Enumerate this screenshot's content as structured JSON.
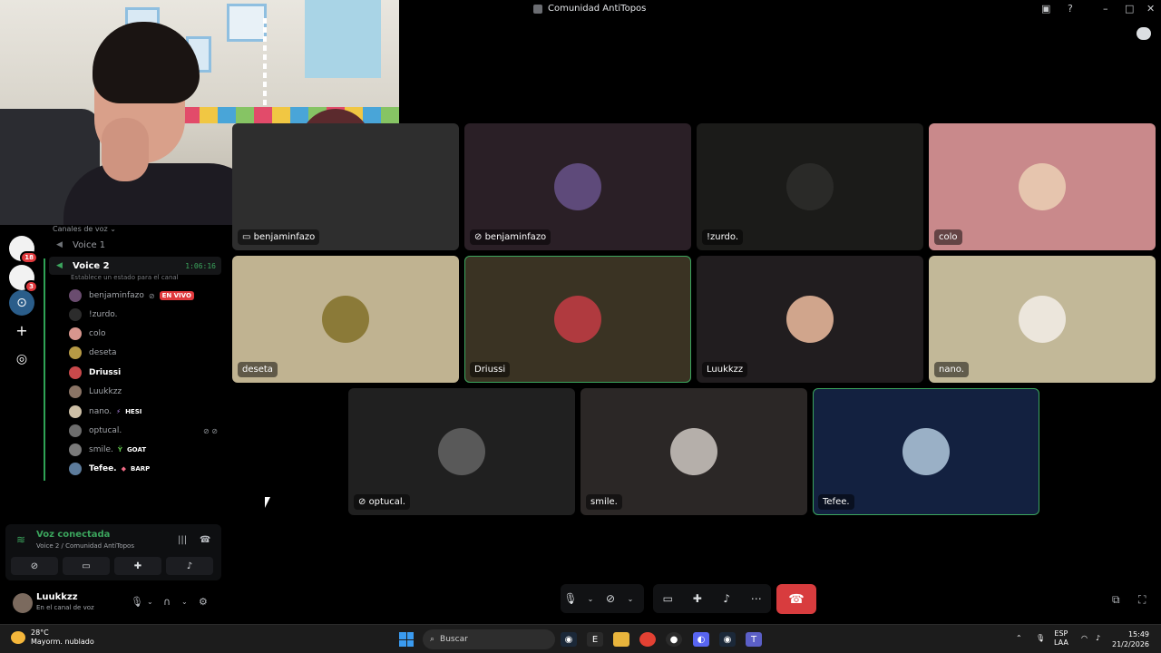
{
  "window": {
    "title": "Comunidad AntiTopos"
  },
  "servers": [
    {
      "badge": "18",
      "color": "#ffffff"
    },
    {
      "badge": "3",
      "color": "#ffffff"
    },
    {
      "badge": "",
      "color": "#2a5d8a"
    }
  ],
  "channels": {
    "category": "Canales de voz",
    "voice1": "Voice 1",
    "voice2": "Voice 2",
    "timer": "1:06:16",
    "status_placeholder": "Establece un estado para el canal"
  },
  "members": [
    {
      "name": "benjaminfazo",
      "live": "EN VIVO",
      "tag": "",
      "color": "#6a4c6f",
      "bold": false
    },
    {
      "name": "!zurdo.",
      "live": "",
      "tag": "",
      "color": "#2c2c2c",
      "bold": false
    },
    {
      "name": "colo",
      "live": "",
      "tag": "",
      "color": "#d8968e",
      "bold": false
    },
    {
      "name": "deseta",
      "live": "",
      "tag": "",
      "color": "#b79a45",
      "bold": false
    },
    {
      "name": "Driussi",
      "live": "",
      "tag": "",
      "color": "#c9494b",
      "bold": true
    },
    {
      "name": "Luukkzz",
      "live": "",
      "tag": "",
      "color": "#8a7465",
      "bold": false
    },
    {
      "name": "nano.",
      "live": "",
      "tag": "HESI",
      "color": "#cdbfa6",
      "bold": false
    },
    {
      "name": "optucal.",
      "live": "",
      "tag": "",
      "color": "#6d6d6d",
      "bold": false
    },
    {
      "name": "smile.",
      "live": "",
      "tag": "GOAT",
      "color": "#7a7a7a",
      "bold": false
    },
    {
      "name": "Tefee.",
      "live": "",
      "tag": "BARP",
      "color": "#5d7c9c",
      "bold": true
    }
  ],
  "voice_panel": {
    "title": "Voz conectada",
    "subtitle": "Voice 2 / Comunidad AntiTopos"
  },
  "user": {
    "name": "Luukkzz",
    "status": "En el canal de voz"
  },
  "tiles": [
    {
      "name": "benjaminfazo",
      "bg": "#2e2e2e",
      "icon": "screen-share-icon"
    },
    {
      "name": "benjaminfazo",
      "bg": "#2a1f26",
      "avatar": "#5e4a7a",
      "icon": "camera-off-icon"
    },
    {
      "name": "!zurdo.",
      "bg": "#1b1b19",
      "avatar": "#2a2a28"
    },
    {
      "name": "colo",
      "bg": "#c9898b",
      "avatar": "#e6c5ae"
    },
    {
      "name": "deseta",
      "bg": "#c0b391",
      "avatar": "#8b7a38"
    },
    {
      "name": "Driussi",
      "bg": "#3a3323",
      "avatar": "#b03a3f"
    },
    {
      "name": "Luukkzz",
      "bg": "#211d1f",
      "avatar": "#d0a58c"
    },
    {
      "name": "nano.",
      "bg": "#c2b898",
      "avatar": "#ece6dc"
    },
    {
      "name": "optucal.",
      "bg": "#202020",
      "avatar": "#595959",
      "icon": "camera-off-icon"
    },
    {
      "name": "smile.",
      "bg": "#2b2726",
      "avatar": "#b5afaa"
    },
    {
      "name": "Tefee.",
      "bg": "#132140",
      "avatar": "#9ab0c6"
    }
  ],
  "taskbar": {
    "weather_temp": "28°C",
    "weather_desc": "Mayorm. nublado",
    "search_placeholder": "Buscar",
    "lang1": "ESP",
    "lang2": "LAA",
    "time": "15:49",
    "date": "21/2/2026"
  }
}
